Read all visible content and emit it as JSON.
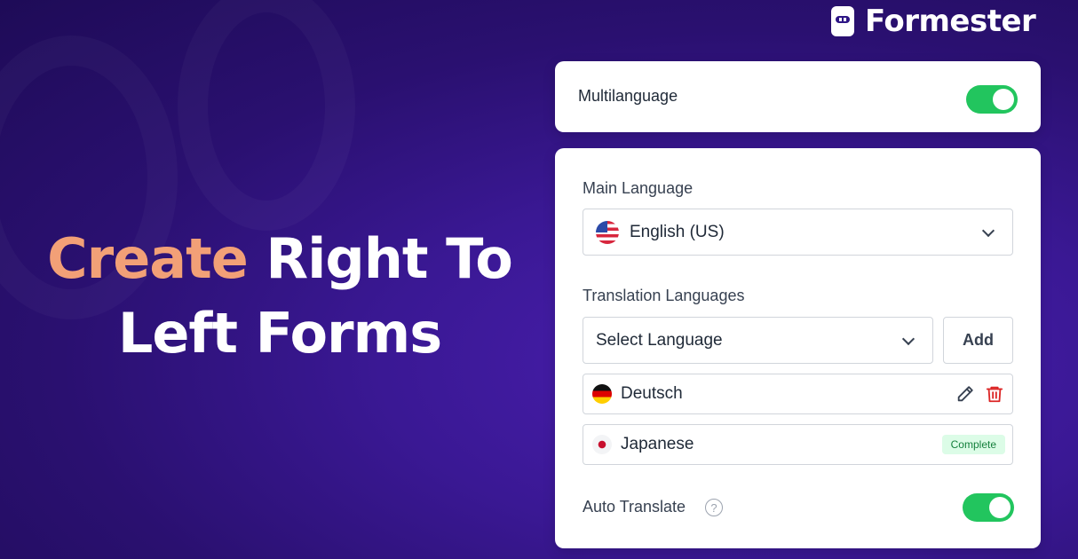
{
  "hero": {
    "accent_word": "Create",
    "rest_line1": " Right To",
    "line2": "Left Forms"
  },
  "brand": {
    "name": "Formester",
    "logo_icon": "formester-logo-icon"
  },
  "multilanguage": {
    "label": "Multilanguage",
    "enabled": true
  },
  "main_language": {
    "label": "Main Language",
    "selected": "English (US)",
    "flag_icon": "us-flag-icon"
  },
  "translation": {
    "label": "Translation Languages",
    "select_placeholder": "Select Language",
    "add_label": "Add",
    "languages": [
      {
        "name": "Deutsch",
        "flag_icon": "german-flag-icon",
        "status": ""
      },
      {
        "name": "Japanese",
        "flag_icon": "japanese-flag-icon",
        "status": "Complete"
      }
    ]
  },
  "auto_translate": {
    "label": "Auto Translate",
    "help_glyph": "?",
    "enabled": true
  },
  "colors": {
    "accent": "#f2a077",
    "toggle_on": "#22c55e",
    "background": "#2a1070",
    "delete": "#dc2626"
  }
}
